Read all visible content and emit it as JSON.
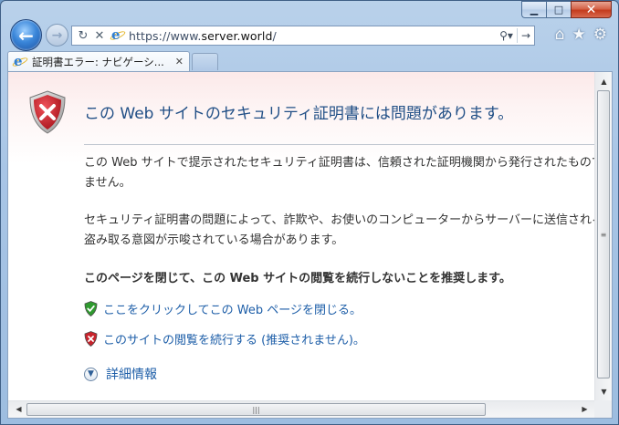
{
  "window": {
    "caption": {
      "minimize_icon": "minimize-icon",
      "maximize_icon": "maximize-icon",
      "close_icon": "close-icon",
      "minimize_glyph": "▁",
      "maximize_glyph": "□",
      "close_glyph": "✕"
    }
  },
  "nav": {
    "back_glyph": "←",
    "forward_glyph": "→"
  },
  "address": {
    "url_prefix": "https://www.",
    "url_host": "server.world",
    "url_suffix": "/",
    "refresh_glyph": "↻",
    "stop_glyph": "✕",
    "search_glyph": "⚲▾",
    "go_glyph": "→"
  },
  "commands": {
    "home_glyph": "⌂",
    "favorites_glyph": "★",
    "tools_glyph": "⚙"
  },
  "tab": {
    "title": "証明書エラー: ナビゲーシ...",
    "close_glyph": "✕"
  },
  "page": {
    "headline": "この Web サイトのセキュリティ証明書には問題があります。",
    "paragraph1": [
      "この Web サイトで提示されたセキュリティ証明書は、信頼された証明機関から発行されたものではあり",
      "ません。"
    ],
    "paragraph2": [
      "セキュリティ証明書の問題によって、詐欺や、お使いのコンピューターからサーバーに送信される情報を",
      "盗み取る意図が示唆されている場合があります。"
    ],
    "recommendation": "このページを閉じて、この Web サイトの閲覧を続行しないことを推奨します。",
    "close_link": "ここをクリックしてこの Web ページを閉じる。",
    "continue_link": "このサイトの閲覧を続行する (推奨されません)。",
    "more_info": "詳細情報"
  },
  "colors": {
    "headline": "#214f86",
    "link": "#1d5ea8",
    "shield_red": "#c8232c",
    "shield_green": "#2f9a2f"
  },
  "scrollbar": {
    "up": "▲",
    "down": "▼",
    "left": "◀",
    "right": "▶",
    "grip_v": "≡",
    "grip_h": "|||"
  }
}
